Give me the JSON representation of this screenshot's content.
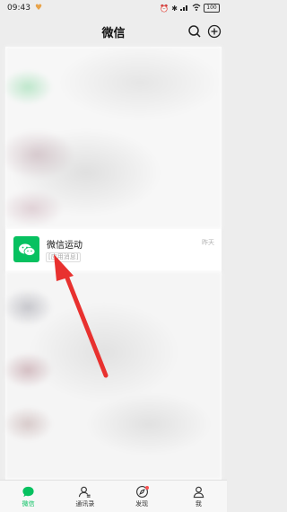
{
  "status": {
    "time": "09:43",
    "battery": "100"
  },
  "header": {
    "title": "微信"
  },
  "chat": {
    "name": "微信运动",
    "tag": "[应用消息]",
    "time": "昨天"
  },
  "tabs": [
    {
      "label": "微信",
      "icon": "chat-icon",
      "active": true
    },
    {
      "label": "通讯录",
      "icon": "contacts-icon",
      "active": false
    },
    {
      "label": "发现",
      "icon": "compass-icon",
      "active": false
    },
    {
      "label": "我",
      "icon": "person-icon",
      "active": false
    }
  ],
  "colors": {
    "accent": "#07c160",
    "badge": "#fa5151",
    "arrow": "#e8312f"
  }
}
